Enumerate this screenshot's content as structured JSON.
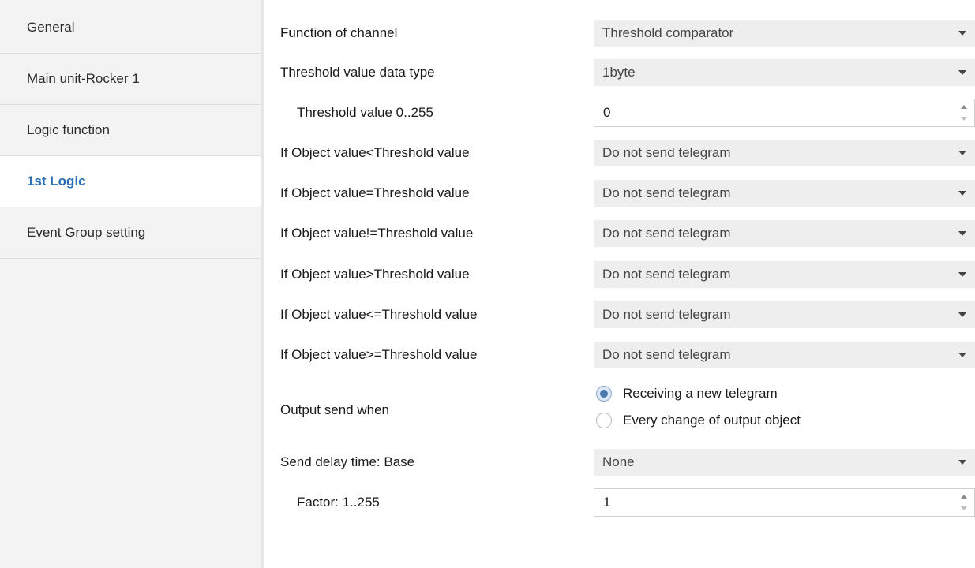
{
  "sidebar": {
    "items": [
      {
        "label": "General"
      },
      {
        "label": "Main unit-Rocker 1"
      },
      {
        "label": "Logic function"
      },
      {
        "label": "1st Logic"
      },
      {
        "label": "Event Group setting"
      }
    ],
    "active": "1st Logic"
  },
  "form": {
    "function_of_channel": {
      "label": "Function of channel",
      "value": "Threshold comparator"
    },
    "threshold_data_type": {
      "label": "Threshold value data type",
      "value": "1byte"
    },
    "threshold_value": {
      "label": "Threshold value 0..255",
      "value": "0"
    },
    "if_less": {
      "label": "If Object value<Threshold value",
      "value": "Do not send telegram"
    },
    "if_equal": {
      "label": "If Object value=Threshold value",
      "value": "Do not send telegram"
    },
    "if_not_equal": {
      "label": "If Object value!=Threshold value",
      "value": "Do not send telegram"
    },
    "if_greater": {
      "label": "If Object value>Threshold value",
      "value": "Do not send telegram"
    },
    "if_less_equal": {
      "label": "If Object value<=Threshold value",
      "value": "Do not send telegram"
    },
    "if_greater_equal": {
      "label": "If Object value>=Threshold value",
      "value": "Do not send telegram"
    },
    "output_send_when": {
      "label": "Output send when",
      "options": [
        "Receiving a new telegram",
        "Every change of output object"
      ],
      "selected": "Receiving a new telegram"
    },
    "send_delay_base": {
      "label": "Send delay time: Base",
      "value": "None"
    },
    "factor": {
      "label": "Factor: 1..255",
      "value": "1"
    }
  },
  "colors": {
    "active_tab": "#2a6fb3",
    "radio_selected": "#4a78ad",
    "select_bg": "#eeeeee"
  },
  "icons": [
    "dropdown-caret-icon",
    "spinner-arrows-icon",
    "radio-icon"
  ]
}
